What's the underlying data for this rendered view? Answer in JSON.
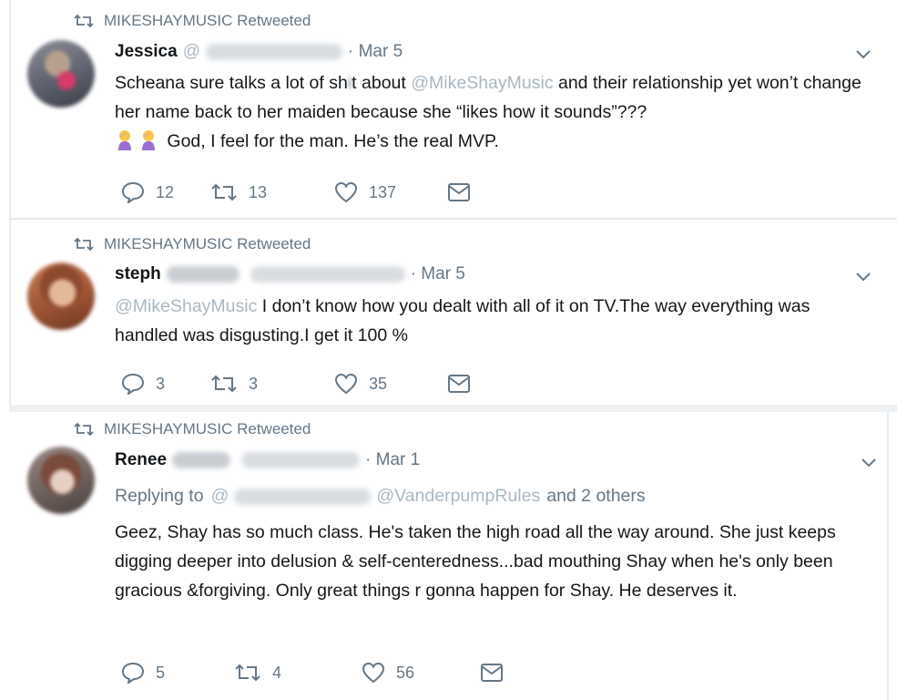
{
  "tweets": [
    {
      "retweeted_by": "MIKESHAYMUSIC Retweeted",
      "name": "Jessica",
      "handle_prefix": "@",
      "date": "· Mar 5",
      "text_part1": "Scheana sure talks a lot of sh",
      "text_censor": "i",
      "text_part2": "t about ",
      "mention": "@MikeShayMusic",
      "text_part3": " and their relationship yet won’t change her name back to her maiden because she “likes how it sounds”???",
      "text_line3": " God, I feel for the man. He’s the real MVP.",
      "emoji": "woman-facepalming-icon",
      "replies": "12",
      "retweets": "13",
      "likes": "137"
    },
    {
      "retweeted_by": "MIKESHAYMUSIC Retweeted",
      "name": "steph",
      "date": "· Mar 5",
      "mention": "@MikeShayMusic",
      "text": " I don’t know how you dealt with all of it on TV.The way everything was handled was disgusting.I get it 100 %",
      "replies": "3",
      "retweets": "3",
      "likes": "35"
    },
    {
      "retweeted_by": "MIKESHAYMUSIC Retweeted",
      "name": "Renee",
      "date": "· Mar 1",
      "replying_to": "Replying to",
      "reply_handle_prefix": "@",
      "reply_mention": "@VanderpumpRules",
      "reply_others": "and 2 others",
      "text": "Geez, Shay has so much class. He's taken the high road all the way around. She just keeps digging deeper into delusion & self-centeredness...bad mouthing Shay when he's only been gracious &forgiving. Only great things r gonna happen for Shay. He deserves it.",
      "replies": "5",
      "retweets": "4",
      "likes": "56"
    }
  ],
  "colors": {
    "text": "#14171a",
    "secondary": "#657786",
    "mention_faded": "#aab8c2",
    "divider": "#e1e8ed"
  }
}
